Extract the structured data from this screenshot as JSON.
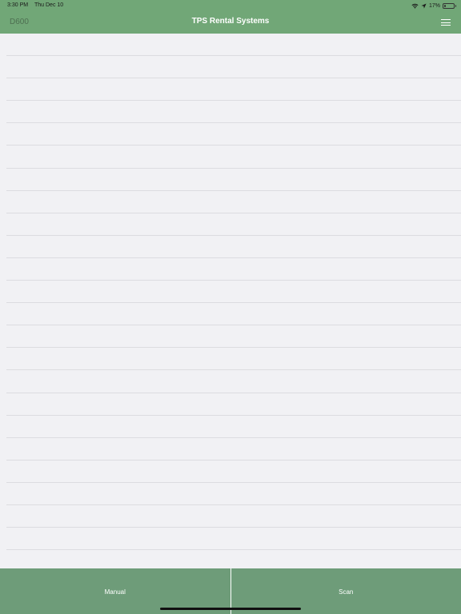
{
  "status_bar": {
    "time": "3:30 PM",
    "date": "Thu Dec 10",
    "battery_percent": "17%",
    "battery_level": 0.17,
    "icons": [
      "wifi-icon",
      "location-arrow-icon",
      "battery-icon"
    ]
  },
  "nav": {
    "left_label": "D600",
    "title": "TPS Rental Systems",
    "menu_icon": "hamburger-menu-icon"
  },
  "list": {
    "row_count": 24
  },
  "bottom_bar": {
    "manual_label": "Manual",
    "scan_label": "Scan"
  },
  "colors": {
    "header": "#71a777",
    "bottom_bar": "#6e9c79",
    "background": "#f1f1f4",
    "divider": "#dcdce0"
  }
}
